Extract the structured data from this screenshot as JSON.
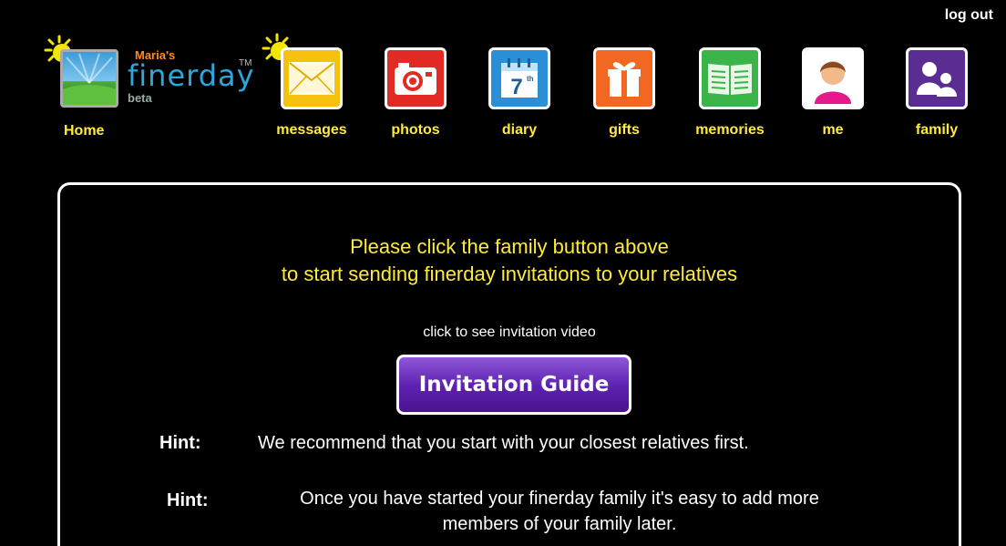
{
  "header": {
    "logout_label": "log out",
    "brand_owner": "Maria's",
    "brand_name": "finerday",
    "brand_tm": "TM",
    "brand_beta": "beta",
    "home_label": "Home"
  },
  "nav": {
    "items": [
      {
        "label": "messages",
        "icon": "envelope-icon",
        "color": "#f4c20d"
      },
      {
        "label": "photos",
        "icon": "camera-icon",
        "color": "#e22b24"
      },
      {
        "label": "diary",
        "icon": "calendar-icon",
        "color": "#2a8fd6"
      },
      {
        "label": "gifts",
        "icon": "gift-icon",
        "color": "#f26722"
      },
      {
        "label": "memories",
        "icon": "book-icon",
        "color": "#3bb54a"
      },
      {
        "label": "me",
        "icon": "person-icon",
        "color": "#ffffff"
      },
      {
        "label": "family",
        "icon": "family-icon",
        "color": "#5b2c91"
      }
    ],
    "diary_day": "7",
    "diary_day_suffix": "th"
  },
  "main": {
    "headline_line1": "Please click the family button above",
    "headline_line2": "to start sending finerday invitations to your relatives",
    "video_caption": "click to see invitation video",
    "guide_button_label": "Invitation Guide",
    "hints": [
      {
        "label": "Hint:",
        "text_line1": "We recommend that you start with your closest relatives first.",
        "text_line2": ""
      },
      {
        "label": "Hint:",
        "text_line1": "Once you have started your finerday family it's easy to add more",
        "text_line2": "members of your family later."
      }
    ]
  },
  "colors": {
    "background": "#000000",
    "accent_yellow": "#ffeb3b",
    "brand_orange": "#ff8a1c",
    "brand_blue": "#2ea6dc",
    "button_purple": "#5d22b0"
  }
}
